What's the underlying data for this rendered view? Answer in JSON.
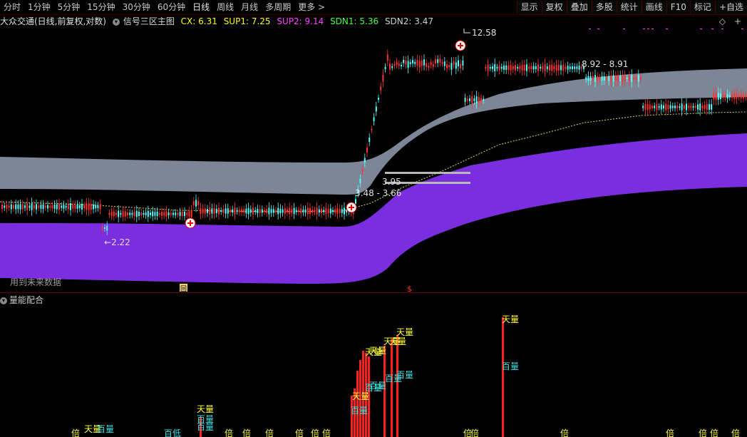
{
  "topbar": {
    "periods": [
      "分时",
      "1分钟",
      "5分钟",
      "15分钟",
      "30分钟",
      "60分钟",
      "日线",
      "周线",
      "月线",
      "多周期",
      "更多"
    ],
    "more_arrow": ">",
    "tools": [
      "显示",
      "复权",
      "叠加",
      "多股",
      "统计",
      "画线",
      "F10",
      "标记",
      "+自选"
    ]
  },
  "title": {
    "stock": "大众交通(日线,前复权,对数)",
    "indicator": "信号三区主图",
    "cx": "CX: 6.31",
    "sup1": "SUP1: 7.25",
    "sup2": "SUP2: 9.14",
    "sdn1": "SDN1: 5.36",
    "sdn2": "SDN2: 3.47",
    "diamond": "◇",
    "plus": "+"
  },
  "annotations": {
    "high": "12.58",
    "low": "2.22",
    "range_right": "8.92 - 8.91",
    "range_mid": "3.48 - 3.66",
    "range_mid2": "3.95",
    "no_future": "用到未来数据",
    "marker_box": "回",
    "marker_s": "$"
  },
  "panel2": {
    "title": "量能配合",
    "labels": [
      "天量",
      "百量",
      "百低",
      "倍"
    ]
  },
  "colors": {
    "purple_band": "#7b2ee0",
    "gray_band": "#7c8696",
    "up": "#ff3232",
    "down": "#54ffff",
    "cx_color": "#ffff00",
    "sup1_color": "#ffff00",
    "sup2_color": "#ff40ff",
    "sdn1_color": "#40ff40",
    "sdn2_color": "#d0d0d0"
  }
}
